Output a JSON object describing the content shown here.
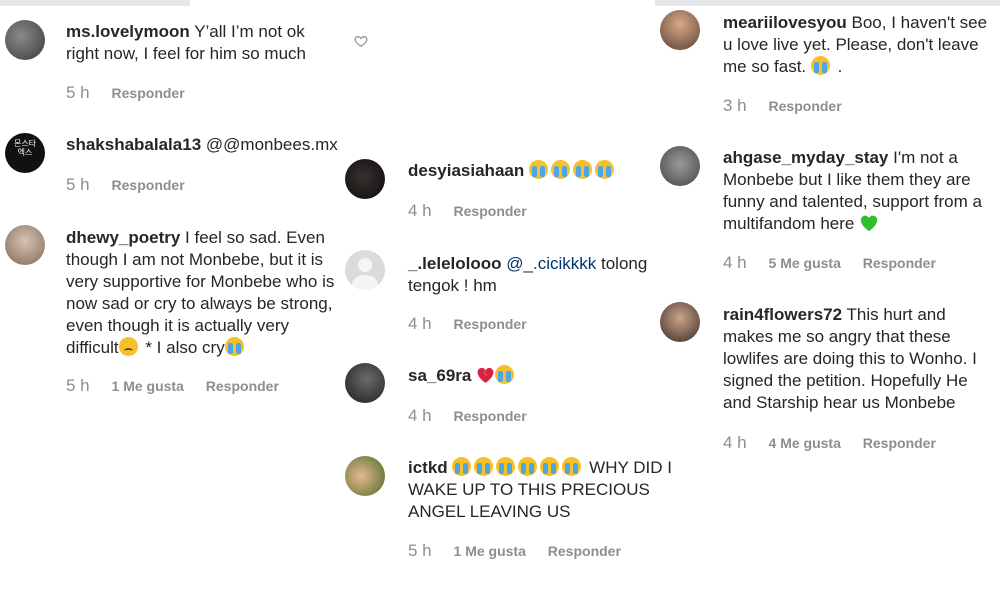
{
  "actions": {
    "reply_label": "Responder"
  },
  "left_column": [
    {
      "username": "ms.lovelymoon",
      "text": "Y’all I’m not ok right now, I feel for him so much",
      "time": "5 h",
      "likes": ""
    },
    {
      "username": "shakshabalala13",
      "text": "@@monbees.mx",
      "time": "5 h",
      "likes": ""
    },
    {
      "username": "dhewy_poetry",
      "text_a": "I feel so sad. Even though I am not Monbebe, but it is very supportive for Monbebe who is now sad or cry to always be strong, even though it is actually very difficult",
      "text_b": " * I also cry",
      "time": "5 h",
      "likes": "1 Me gusta"
    }
  ],
  "middle_column": [
    {
      "username": "desyiasiahaan",
      "text": "",
      "time": "4 h",
      "likes": ""
    },
    {
      "username": "_.lelelolooo",
      "mention": "@_.cicikkkk",
      "text": " tolong tengok ! hm",
      "time": "4 h",
      "likes": ""
    },
    {
      "username": "sa_69ra",
      "text": "",
      "time": "4 h",
      "likes": ""
    },
    {
      "username": "ictkd",
      "text": "WHY DID I WAKE UP TO THIS PRECIOUS ANGEL LEAVING US",
      "time": "5 h",
      "likes": "1 Me gusta"
    }
  ],
  "right_column": [
    {
      "username": "meariilovesyou",
      "text_a": "Boo, I haven't see u love live yet. Please, don't leave me so fast.",
      "text_b": " .",
      "time": "3 h",
      "likes": ""
    },
    {
      "username": "ahgase_myday_stay",
      "text": "I'm not a Monbebe but I like them they are funny and talented, support from a multifandom here",
      "time": "4 h",
      "likes": "5 Me gusta"
    },
    {
      "username": "rain4flowers72",
      "text": "This hurt and makes me so angry that these lowlifes are doing this to Wonho. I signed the petition. Hopefully He and Starship hear us Monbebe",
      "time": "4 h",
      "likes": "4 Me gusta"
    }
  ],
  "avatar_badge": {
    "shakshabalala13": "몬스타엑스"
  },
  "colors": {
    "username": "#262626",
    "meta": "#8e8e8e",
    "mention": "#00376b",
    "green_heart": "#2fbf2f",
    "red_heart": "#d8213b"
  }
}
